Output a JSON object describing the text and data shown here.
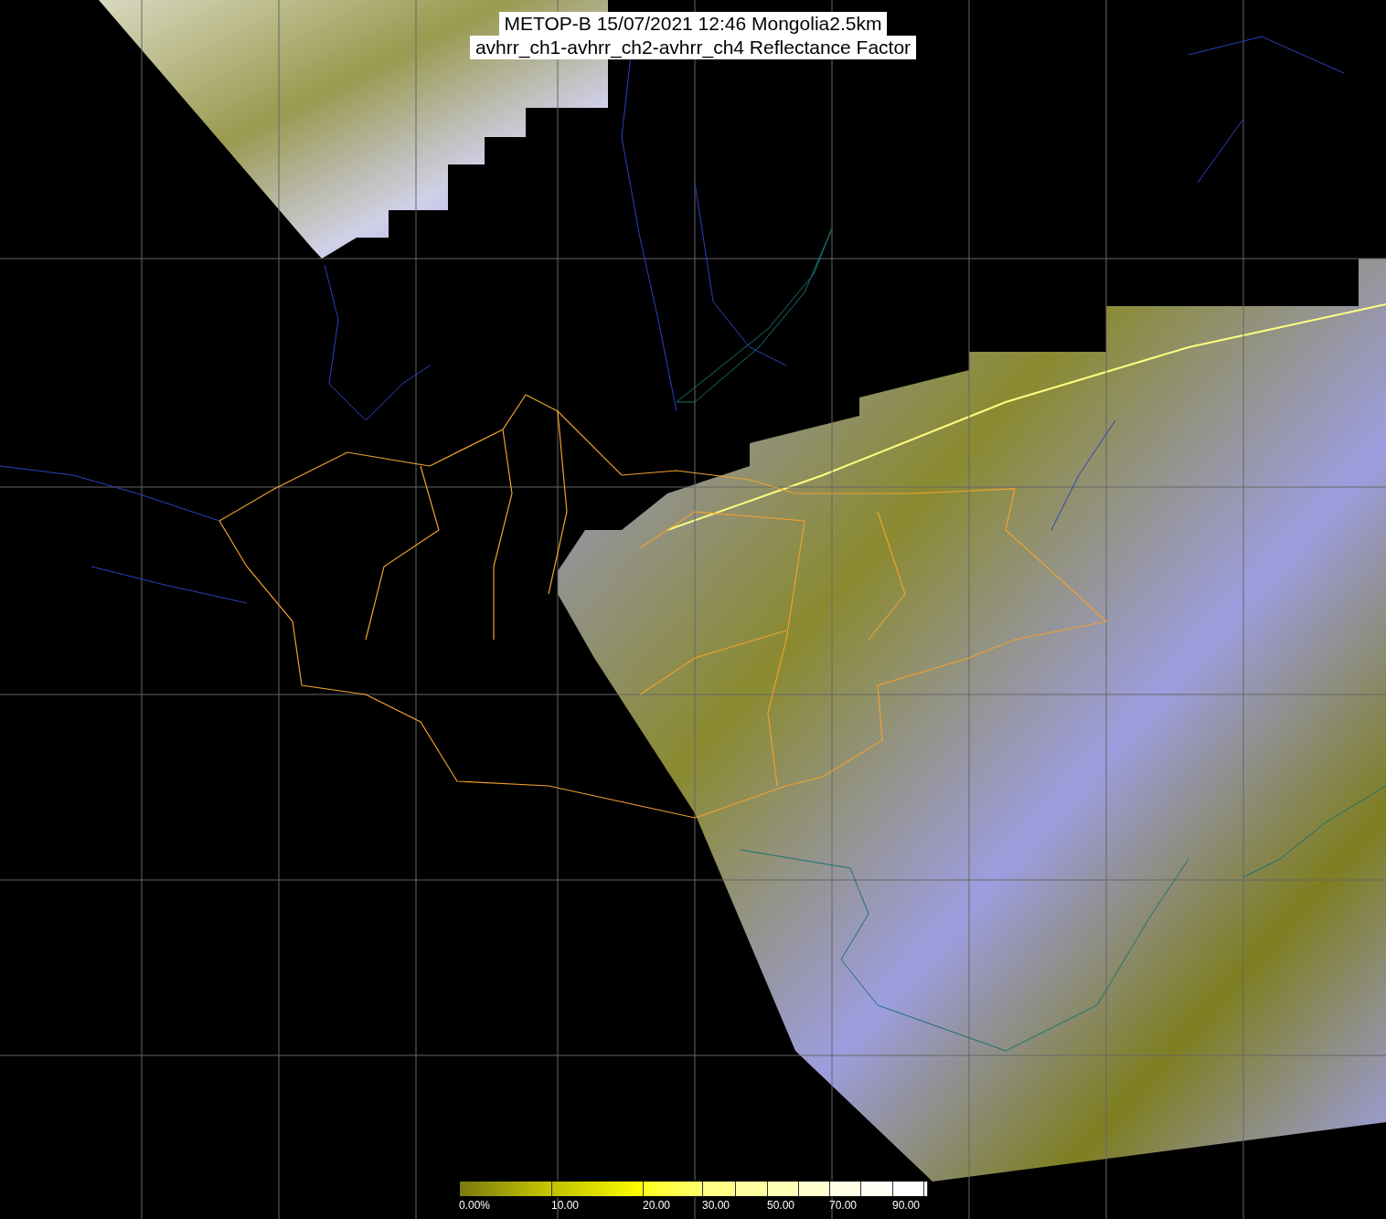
{
  "title_lines": [
    "METOP-B 15/07/2021 12:46 Mongolia2.5km",
    "avhrr_ch1-avhrr_ch2-avhrr_ch4 Reflectance Factor"
  ],
  "colorbar": {
    "labels": [
      "0.00%",
      "10.00",
      "20.00",
      "30.00",
      "50.00",
      "70.00",
      "90.00"
    ]
  }
}
